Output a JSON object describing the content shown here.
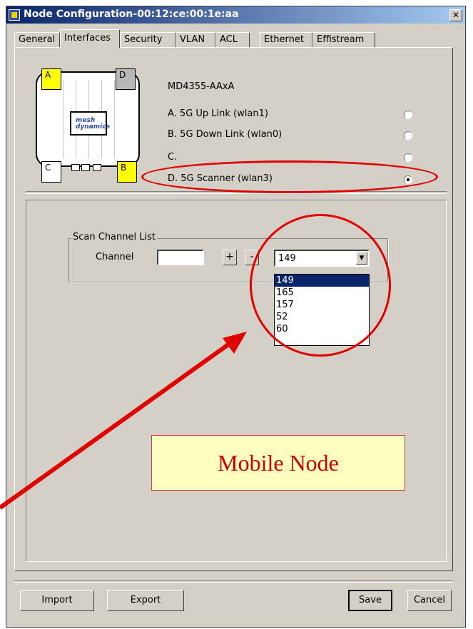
{
  "window": {
    "title": "Node Configuration-00:12:ce:00:1e:aa"
  },
  "tabs": [
    "General",
    "Interfaces",
    "Security",
    "VLAN",
    "ACL",
    "Ethernet",
    "Effistream"
  ],
  "device": {
    "model": "MD4355-AAxA",
    "ports": {
      "a": "A",
      "b": "B",
      "c": "C",
      "d": "D"
    },
    "logo_text": "mesh dynamics"
  },
  "interfaces": [
    {
      "label": "A. 5G  Up Link (wlan1)",
      "checked": false
    },
    {
      "label": "B. 5G  Down Link (wlan0)",
      "checked": false
    },
    {
      "label": "C.",
      "checked": false
    },
    {
      "label": "D. 5G  Scanner (wlan3)",
      "checked": true
    }
  ],
  "scan": {
    "group_label": "Scan Channel List",
    "channel_label": "Channel",
    "channel_value": "",
    "add_label": "+",
    "remove_label": "-",
    "selected": "149",
    "options": [
      "149",
      "165",
      "157",
      "52",
      "60"
    ]
  },
  "callout": {
    "text": "Mobile Node"
  },
  "buttons": {
    "import": "Import",
    "export": "Export",
    "save": "Save",
    "cancel": "Cancel"
  },
  "colors": {
    "annotation": "#e00000",
    "callout_bg": "#ffffc0",
    "title_bar": "#0a246a"
  }
}
